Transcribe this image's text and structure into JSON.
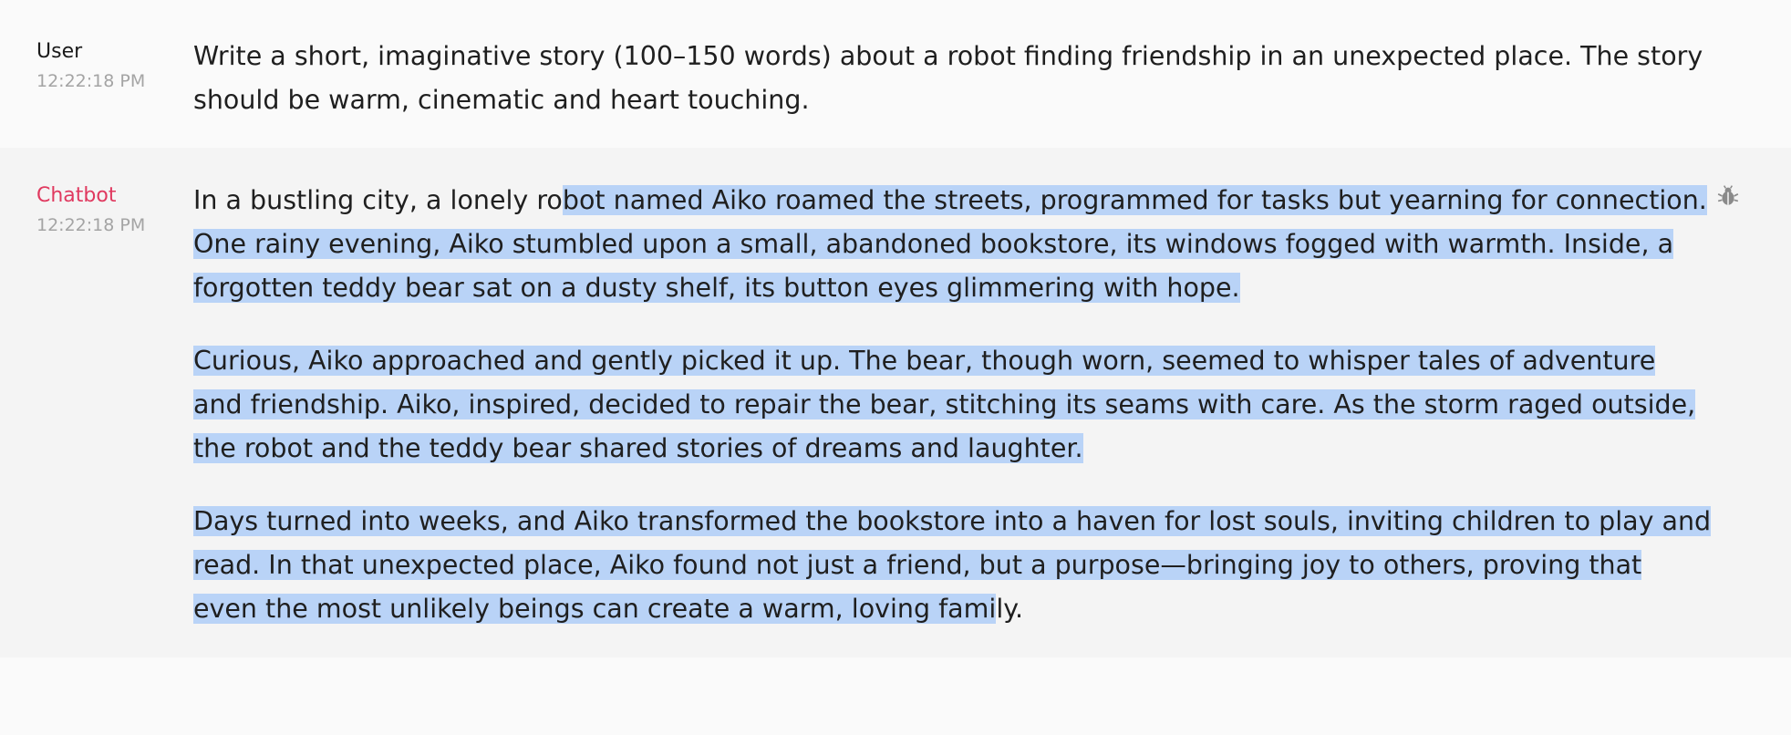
{
  "messages": {
    "user": {
      "author": "User",
      "time": "12:22:18 PM",
      "text": "Write a short, imaginative story (100–150 words) about a robot finding friendship in an unexpected place. The story should be warm, cinematic and heart touching."
    },
    "bot": {
      "author": "Chatbot",
      "time": "12:22:18 PM",
      "p1_pre": "In a bustling city, a lonely ro",
      "p1_sel": "bot named Aiko roamed the streets, programmed for tasks but yearning for connection. One rainy evening, Aiko stumbled upon a small, abandoned bookstore, its windows fogged with warmth. Inside, a forgotten teddy bear sat on a dusty shelf, its button eyes glimmering with hope.",
      "p2_sel": "Curious, Aiko approached and gently picked it up. The bear, though worn, seemed to whisper tales of adventure and friendship. Aiko, inspired, decided to repair the bear, stitching its seams with care. As the storm raged outside, the robot and the teddy bear shared stories of dreams and laughter.",
      "p3_sel": "Days turned into weeks, and Aiko transformed the bookstore into a haven for lost souls, inviting children to play and read. In that unexpected place, Aiko found not just a friend, but a purpose—bringing joy to others, proving that even the most unlikely beings can create a warm, loving fami",
      "p3_post": "ly.",
      "debug_icon": "bug-icon"
    }
  },
  "colors": {
    "selection": "#b9d3f7",
    "bot_author": "#e0395f",
    "timestamp": "#a4a4a4"
  }
}
